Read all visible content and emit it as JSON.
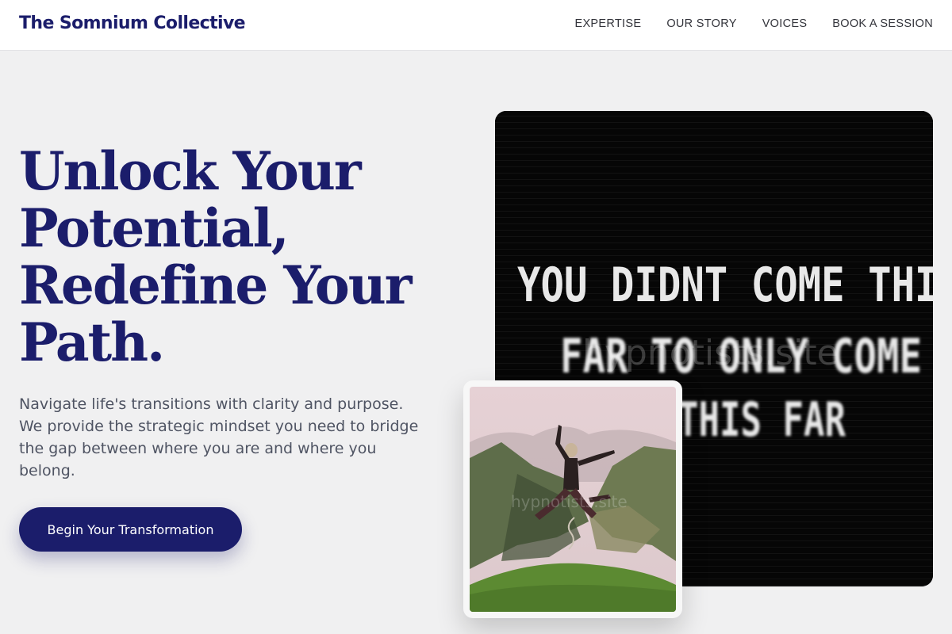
{
  "header": {
    "brand": "The Somnium Collective",
    "nav": [
      "EXPERTISE",
      "OUR STORY",
      "VOICES",
      "BOOK A SESSION"
    ]
  },
  "hero": {
    "title": "Unlock Your Potential, Redefine Your Path.",
    "subtitle": "Navigate life's transitions with clarity and purpose. We provide the strategic mindset you need to bridge the gap between where you are and where you belong.",
    "cta_label": "Begin Your Transformation"
  },
  "letter_board": {
    "lines": [
      "YOU DIDNT COME THIS",
      "FAR TO ONLY COME",
      "THIS FAR"
    ],
    "watermark": "hypnotists.site"
  },
  "photo": {
    "watermark": "hypnotists.site"
  },
  "colors": {
    "brand": "#1b1d6b",
    "background": "#f0f0f1",
    "text_muted": "#4f5463"
  }
}
